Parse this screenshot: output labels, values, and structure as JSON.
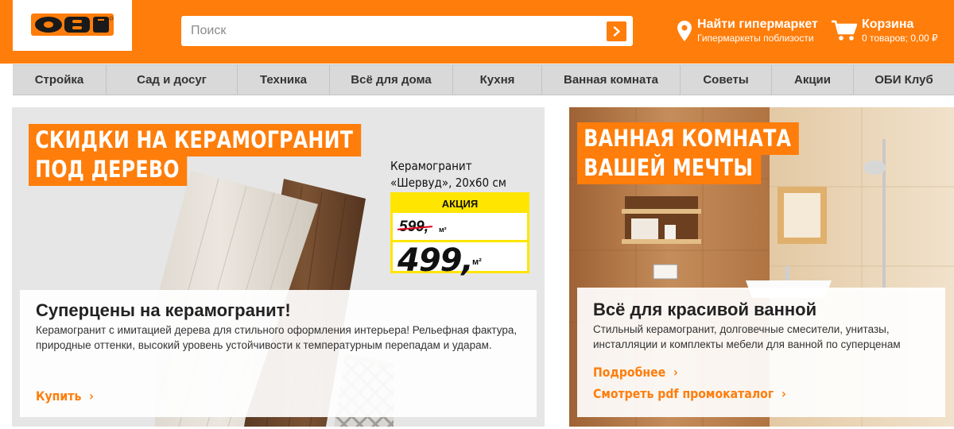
{
  "header": {
    "logo_text": "OBI",
    "search_placeholder": "Поиск",
    "store_title": "Найти гипермаркет",
    "store_subtitle": "Гипермаркеты поблизости",
    "cart_title": "Корзина",
    "cart_subtitle": "0 товаров; 0,00 ₽"
  },
  "nav": {
    "items": [
      {
        "label": "Стройка"
      },
      {
        "label": "Сад и досуг"
      },
      {
        "label": "Техника"
      },
      {
        "label": "Всё для дома"
      },
      {
        "label": "Кухня"
      },
      {
        "label": "Ванная комната"
      },
      {
        "label": "Советы"
      },
      {
        "label": "Акции"
      },
      {
        "label": "ОБИ Клуб"
      }
    ]
  },
  "promo_left": {
    "headline_line1": "СКИДКИ НА КЕРАМОГРАНИТ",
    "headline_line2": "ПОД ДЕРЕВО",
    "product_line1": "Керамогранит",
    "product_line2": "«Шервуд», 20х60 см",
    "price_tag": "АКЦИЯ",
    "old_price": "599,",
    "old_unit": "м²",
    "new_price": "499,",
    "new_unit": "м²",
    "card_title": "Суперцены на керамогранит!",
    "card_text": "Керамогранит с имитацией дерева для стильного оформления интерьера! Рельефная фактура, природные оттенки, высокий уровень устойчивости к температурным перепадам и ударам.",
    "card_link": "Купить"
  },
  "promo_right": {
    "headline_line1": "ВАННАЯ КОМНАТА",
    "headline_line2": "ВАШЕЙ МЕЧТЫ",
    "card_title": "Всё для красивой ванной",
    "card_text": "Стильный керамогранит, долговечные смесители, унитазы, инсталляции и комплекты мебели для ванной по суперценам",
    "link1": "Подробнее",
    "link2": "Смотреть pdf промокаталог"
  },
  "colors": {
    "brand_orange": "#ff7d0a",
    "promo_yellow": "#ffe500",
    "nav_grey": "#d9d9d9"
  }
}
